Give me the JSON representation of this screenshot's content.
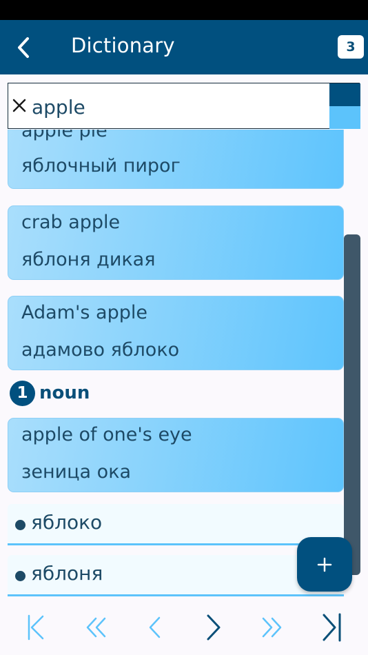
{
  "app_bar": {
    "title": "Dictionary",
    "badge": "3"
  },
  "search": {
    "value": "apple"
  },
  "entries": [
    {
      "term": "apple pie",
      "translation": "яблочный пирог"
    },
    {
      "term": "crab apple",
      "translation": "яблоня дикая"
    },
    {
      "term": "Adam's apple",
      "translation": "адамово яблоко"
    },
    {
      "term": "apple of one's eye",
      "translation": "зеница ока"
    }
  ],
  "part_of_speech": {
    "number": "1",
    "label": "noun"
  },
  "meanings": [
    "яблоко",
    "яблоня"
  ],
  "colors": {
    "header": "#01507f",
    "accent": "#5cc3fb",
    "card_start": "#a9defc",
    "card_end": "#5ec4fd",
    "nav_active": "#0a4f78",
    "nav_inactive": "#5cc3fb"
  },
  "icons": {
    "back": "chevron-left-icon",
    "clear": "close-icon",
    "add": "plus-icon",
    "nav": [
      "first-page-icon",
      "double-chevron-left-icon",
      "chevron-left-icon",
      "chevron-right-icon",
      "double-chevron-right-icon",
      "last-page-icon"
    ]
  }
}
